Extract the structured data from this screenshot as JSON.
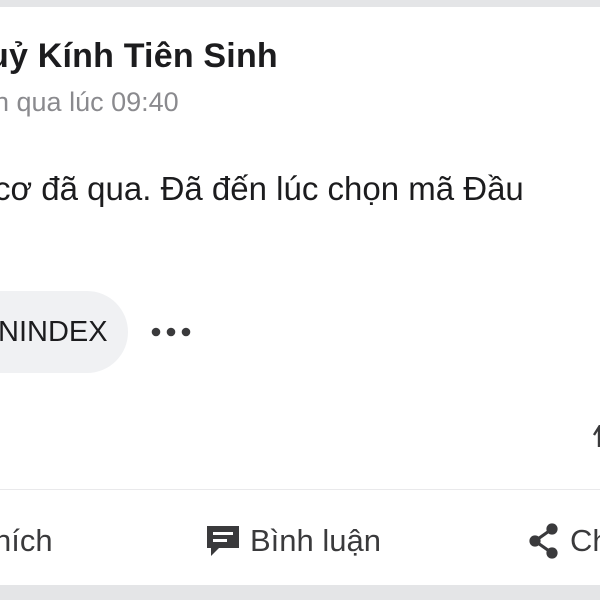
{
  "post": {
    "author": "uỷ Kính Tiên Sinh",
    "timestamp": "n qua lúc 09:40",
    "text": "cơ đã qua. Đã đến lúc chọn mã Đầu",
    "tag": "NINDEX"
  },
  "actions": {
    "like_label": "hích",
    "comment_label": "Bình luận",
    "share_label": "Ch"
  },
  "icons": {
    "more": "more-horizontal-icon",
    "comment": "comment-icon",
    "share": "share-icon"
  },
  "colors": {
    "background": "#e4e5e7",
    "card": "#ffffff",
    "text": "#1c1c1e",
    "muted": "#8a8a8e",
    "chip": "#f0f1f3",
    "icon": "#3a3a3c"
  }
}
